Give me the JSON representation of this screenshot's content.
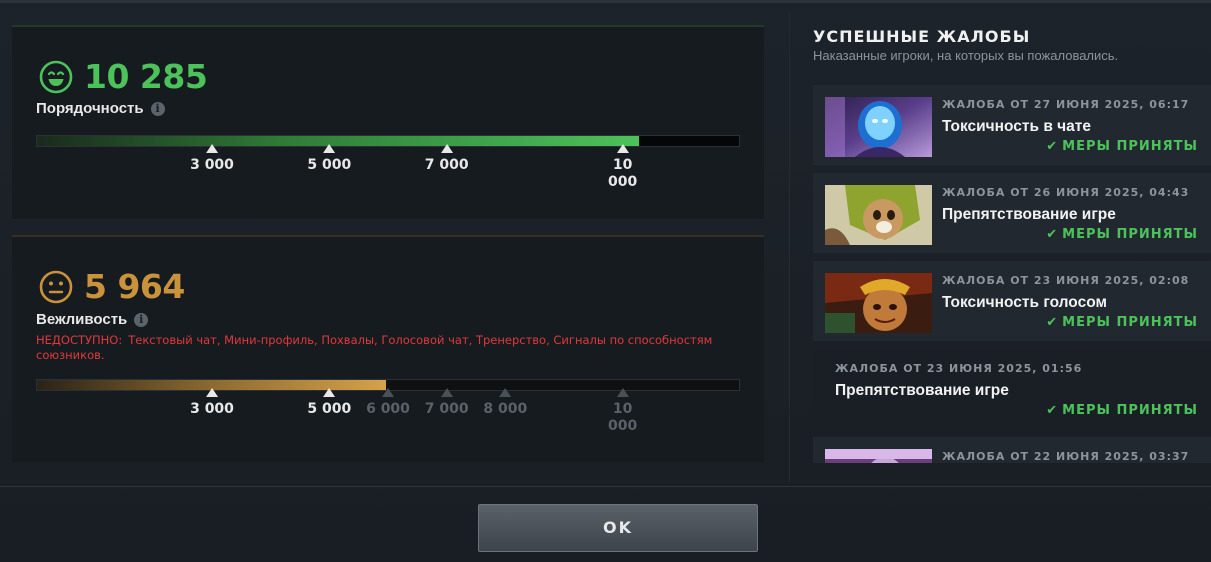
{
  "decency": {
    "score": "10 285",
    "label": "Порядочность",
    "info": "i",
    "fill_fraction": 0.857,
    "markers": [
      {
        "label": "3 000",
        "pos": 0.25,
        "active": true
      },
      {
        "label": "5 000",
        "pos": 0.4167,
        "active": true
      },
      {
        "label": "7 000",
        "pos": 0.5833,
        "active": true
      },
      {
        "label": "10 000",
        "pos": 0.8333,
        "active": true
      }
    ],
    "color": "#4cc25a"
  },
  "politeness": {
    "score": "5 964",
    "label": "Вежливость",
    "info": "i",
    "unavailable_prefix": "НЕДОСТУПНО:",
    "unavailable_text": "Текстовый чат, Мини-профиль, Похвалы, Голосовой чат, Тренерство, Сигналы по способностям союзников.",
    "fill_fraction": 0.497,
    "markers": [
      {
        "label": "3 000",
        "pos": 0.25,
        "active": true
      },
      {
        "label": "5 000",
        "pos": 0.4167,
        "active": true
      },
      {
        "label": "6 000",
        "pos": 0.5,
        "active": false
      },
      {
        "label": "7 000",
        "pos": 0.5833,
        "active": false
      },
      {
        "label": "8 000",
        "pos": 0.6667,
        "active": false
      },
      {
        "label": "10 000",
        "pos": 0.8333,
        "active": false
      }
    ],
    "color": "#c9923b"
  },
  "reports_panel": {
    "title": "УСПЕШНЫЕ ЖАЛОБЫ",
    "subtitle": "Наказанные игроки, на которых вы пожаловались.",
    "items": [
      {
        "date": "ЖАЛОБА ОТ 27 ИЮНЯ 2025, 06:17",
        "reason": "Токсичность в чате",
        "status": "МЕРЫ ПРИНЯТЫ",
        "hero": "arc-warden"
      },
      {
        "date": "ЖАЛОБА ОТ 26 ИЮНЯ 2025, 04:43",
        "reason": "Препятствование игре",
        "status": "МЕРЫ ПРИНЯТЫ",
        "hero": "hoodwink"
      },
      {
        "date": "ЖАЛОБА ОТ 23 ИЮНЯ 2025, 02:08",
        "reason": "Токсичность голосом",
        "status": "МЕРЫ ПРИНЯТЫ",
        "hero": "monkey-king"
      },
      {
        "date": "ЖАЛОБА ОТ 23 ИЮНЯ 2025, 01:56",
        "reason": "Препятствование игре",
        "status": "МЕРЫ ПРИНЯТЫ",
        "hero": ""
      },
      {
        "date": "ЖАЛОБА ОТ 22 ИЮНЯ 2025, 03:37",
        "reason": "",
        "status": "",
        "hero": "dazzle"
      }
    ]
  },
  "footer": {
    "ok_label": "OK"
  }
}
